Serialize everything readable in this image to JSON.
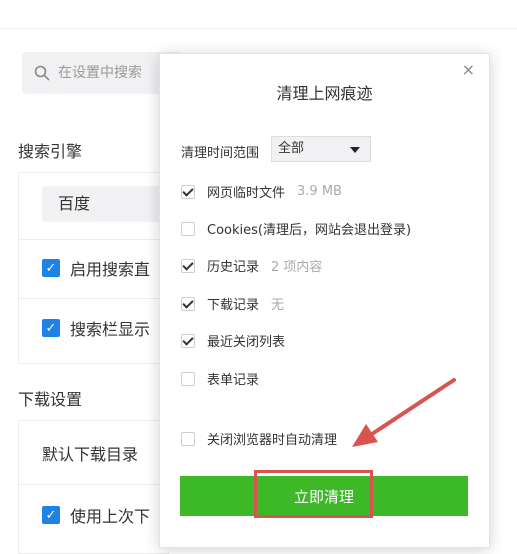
{
  "background": {
    "search": {
      "placeholder": "在设置中搜索",
      "icon": "search-icon"
    },
    "search_engine": {
      "title": "搜索引擎",
      "selected": "百度",
      "options": [
        {
          "label": "启用搜索直",
          "checked": true
        },
        {
          "label": "搜索栏显示",
          "checked": true
        }
      ]
    },
    "download": {
      "title": "下载设置",
      "default_dir_label": "默认下载目录",
      "use_last_label": "使用上次下",
      "use_last_checked": true
    }
  },
  "dialog": {
    "title": "清理上网痕迹",
    "close_icon": "close-icon",
    "range_label": "清理时间范围",
    "range_value": "全部",
    "options": [
      {
        "label": "网页临时文件",
        "detail": "3.9 MB",
        "checked": true
      },
      {
        "label": "Cookies(清理后，网站会退出登录)",
        "detail": "",
        "checked": false
      },
      {
        "label": "历史记录",
        "detail": "2 项内容",
        "checked": true
      },
      {
        "label": "下载记录",
        "detail": "无",
        "checked": true
      },
      {
        "label": "最近关闭列表",
        "detail": "",
        "checked": true
      },
      {
        "label": "表单记录",
        "detail": "",
        "checked": false
      }
    ],
    "auto_clear": {
      "label": "关闭浏览器时自动清理",
      "checked": false
    },
    "clear_button": "立即清理"
  },
  "colors": {
    "accent_blue": "#1f82e6",
    "button_green": "#3db827",
    "annotation_red": "#d9534f"
  }
}
